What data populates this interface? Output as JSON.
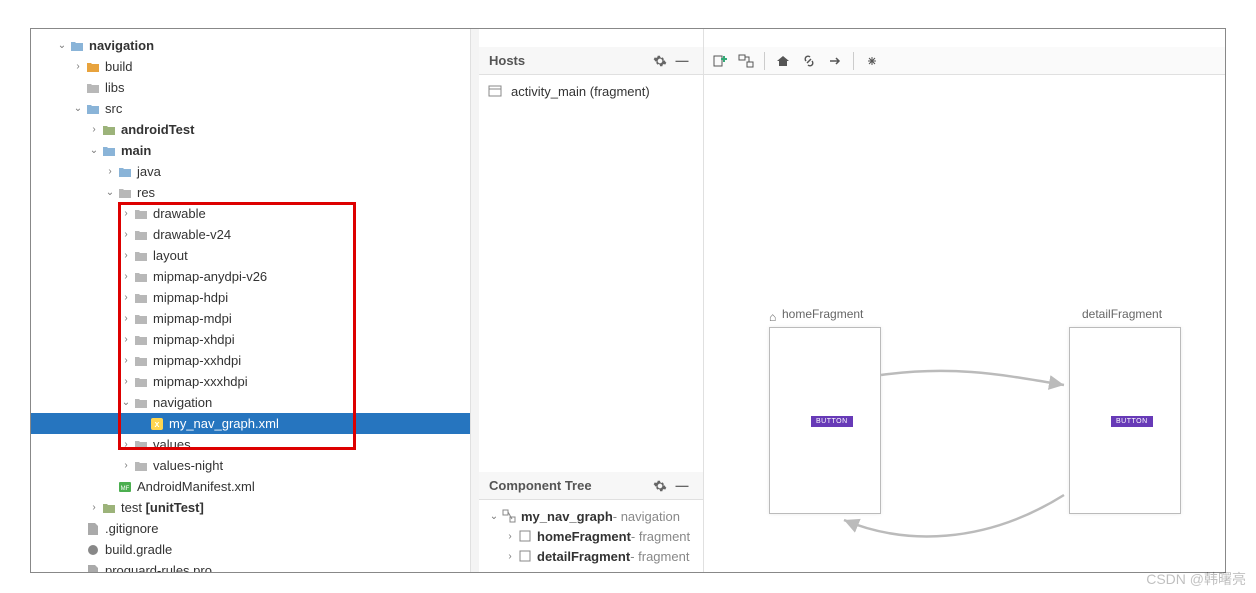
{
  "project_tree": {
    "root": "navigation",
    "build": "build",
    "libs": "libs",
    "src": "src",
    "androidTest": "androidTest",
    "main": "main",
    "java": "java",
    "res": "res",
    "drawable": "drawable",
    "drawable_v24": "drawable-v24",
    "layout": "layout",
    "mipmap_anydpi": "mipmap-anydpi-v26",
    "mipmap_hdpi": "mipmap-hdpi",
    "mipmap_mdpi": "mipmap-mdpi",
    "mipmap_xhdpi": "mipmap-xhdpi",
    "mipmap_xxhdpi": "mipmap-xxhdpi",
    "mipmap_xxxhdpi": "mipmap-xxxhdpi",
    "navigation": "navigation",
    "my_nav_graph": "my_nav_graph.xml",
    "values": "values",
    "values_night": "values-night",
    "manifest": "AndroidManifest.xml",
    "test": "test ",
    "test_scope": "[unitTest]",
    "gitignore": ".gitignore",
    "build_gradle": "build.gradle",
    "proguard": "proguard-rules.pro"
  },
  "hosts_panel": {
    "title": "Hosts",
    "item": "activity_main (fragment)"
  },
  "component_tree": {
    "title": "Component Tree",
    "root_name": "my_nav_graph",
    "root_type": " - navigation",
    "home_name": "homeFragment",
    "home_type": " - fragment",
    "detail_name": "detailFragment",
    "detail_type": " - fragment"
  },
  "canvas": {
    "home_label": "homeFragment",
    "detail_label": "detailFragment",
    "button_text": "BUTTON"
  },
  "watermark": "CSDN @韩曙亮"
}
